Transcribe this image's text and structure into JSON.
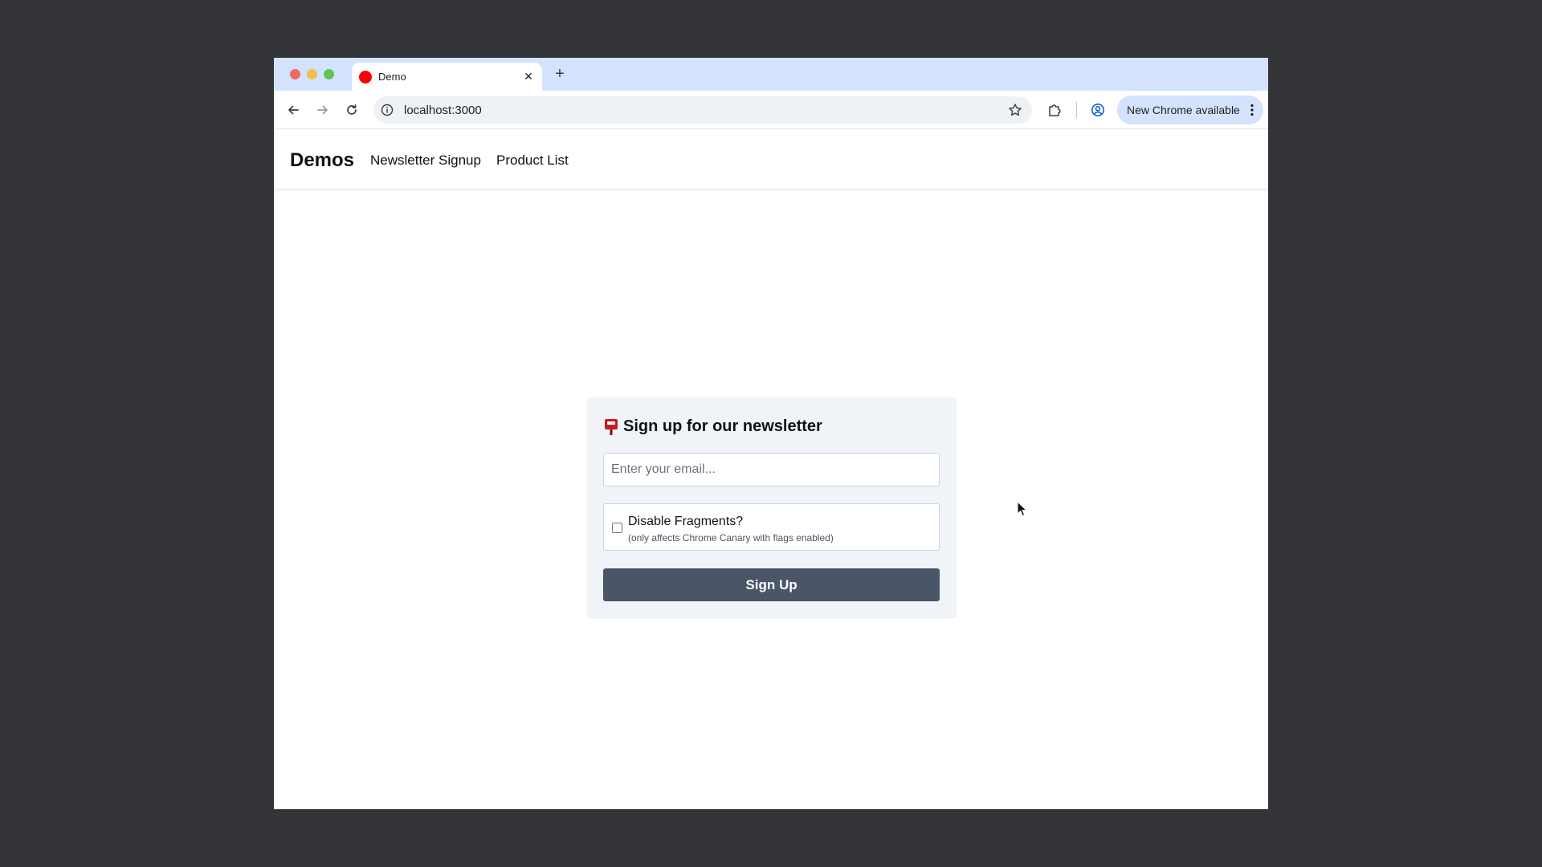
{
  "browser": {
    "tab": {
      "title": "Demo",
      "close_glyph": "✕"
    },
    "new_tab_glyph": "+",
    "address_bar": {
      "url": "localhost:3000"
    },
    "update_button": {
      "label": "New Chrome available"
    },
    "icons": [
      "back-arrow-icon",
      "forward-arrow-icon",
      "reload-icon",
      "site-info-icon",
      "bookmark-star-icon",
      "extensions-icon",
      "profile-icon",
      "more-vert-icon"
    ]
  },
  "site": {
    "brand": "Demos",
    "nav": [
      {
        "label": "Newsletter Signup"
      },
      {
        "label": "Product List"
      }
    ]
  },
  "signup_card": {
    "title": "Sign up for our newsletter",
    "title_icon": "mailbox-icon",
    "email": {
      "value": "",
      "placeholder": "Enter your email..."
    },
    "checkbox": {
      "checked": false,
      "label": "Disable Fragments?",
      "hint": "(only affects Chrome Canary with flags enabled)"
    },
    "submit_label": "Sign Up"
  },
  "colors": {
    "background": "#333438",
    "tab_strip": "#d3e3fd",
    "card_background": "#f0f4f8",
    "button": "#4a5568",
    "favicon": "#ff0000"
  }
}
